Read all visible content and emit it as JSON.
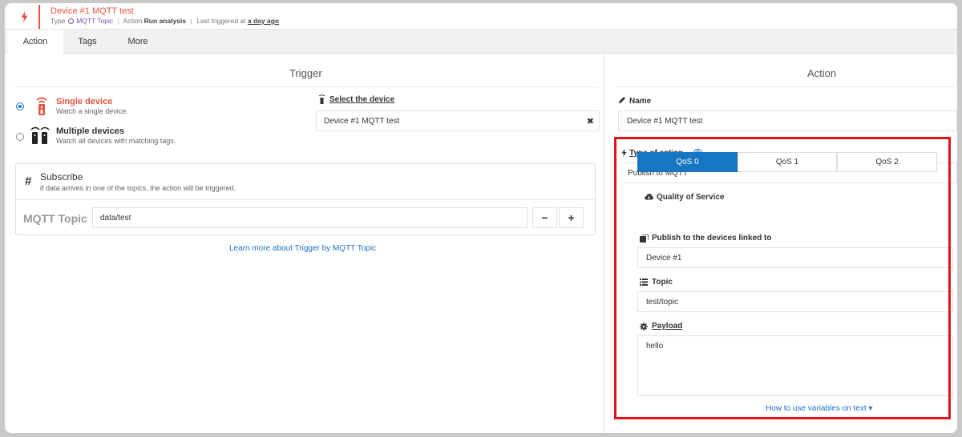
{
  "header": {
    "title": "Device #1 MQTT test",
    "type_label": "Type",
    "type_value": "MQTT Topic",
    "action_label": "Action",
    "action_value": "Run analysis",
    "last_label": "Last triggered at",
    "last_value": "a day ago",
    "separator": "|",
    "accent": "#e8533e",
    "icon": "lightning-icon"
  },
  "tabs": [
    {
      "label": "Action",
      "active": true
    },
    {
      "label": "Tags",
      "active": false
    },
    {
      "label": "More",
      "active": false
    }
  ],
  "trigger": {
    "title": "Trigger",
    "options": [
      {
        "title": "Single device",
        "subtitle": "Watch a single device.",
        "selected": true,
        "icon": "single-device-icon"
      },
      {
        "title": "Multiple devices",
        "subtitle": "Watch all devices with matching tags.",
        "selected": false,
        "icon": "multiple-devices-icon"
      }
    ],
    "select_device_label": "Select the device",
    "selected_device": "Device #1 MQTT test",
    "clear_glyph": "✖",
    "subscribe": {
      "hash": "#",
      "title": "Subscribe",
      "description": "if data arrives in one of the topics, the action will be triggered.",
      "topic_label": "MQTT Topic",
      "topic_value": "data/test",
      "minus": "−",
      "plus": "+"
    },
    "learn_more": "Learn more about Trigger by MQTT Topic"
  },
  "action": {
    "title": "Action",
    "name_label": "Name",
    "name_value": "Device #1 MQTT test",
    "type_label": "Type of action",
    "type_help": "?",
    "type_value": "Publish to MQTT",
    "qos_label": "Quality of Service",
    "qos_options": [
      {
        "label": "QoS 0",
        "active": true
      },
      {
        "label": "QoS 1",
        "active": false
      },
      {
        "label": "QoS 2",
        "active": false
      }
    ],
    "publish_label": "Publish to the devices linked to",
    "publish_value": "Device #1",
    "topic_label": "Topic",
    "topic_value": "test/topic",
    "payload_label": "Payload",
    "payload_value": "hello",
    "variables_link": "How to use variables on text",
    "variables_caret": "▾",
    "highlight_color": "#e2141b",
    "active_color": "#1776c2"
  }
}
